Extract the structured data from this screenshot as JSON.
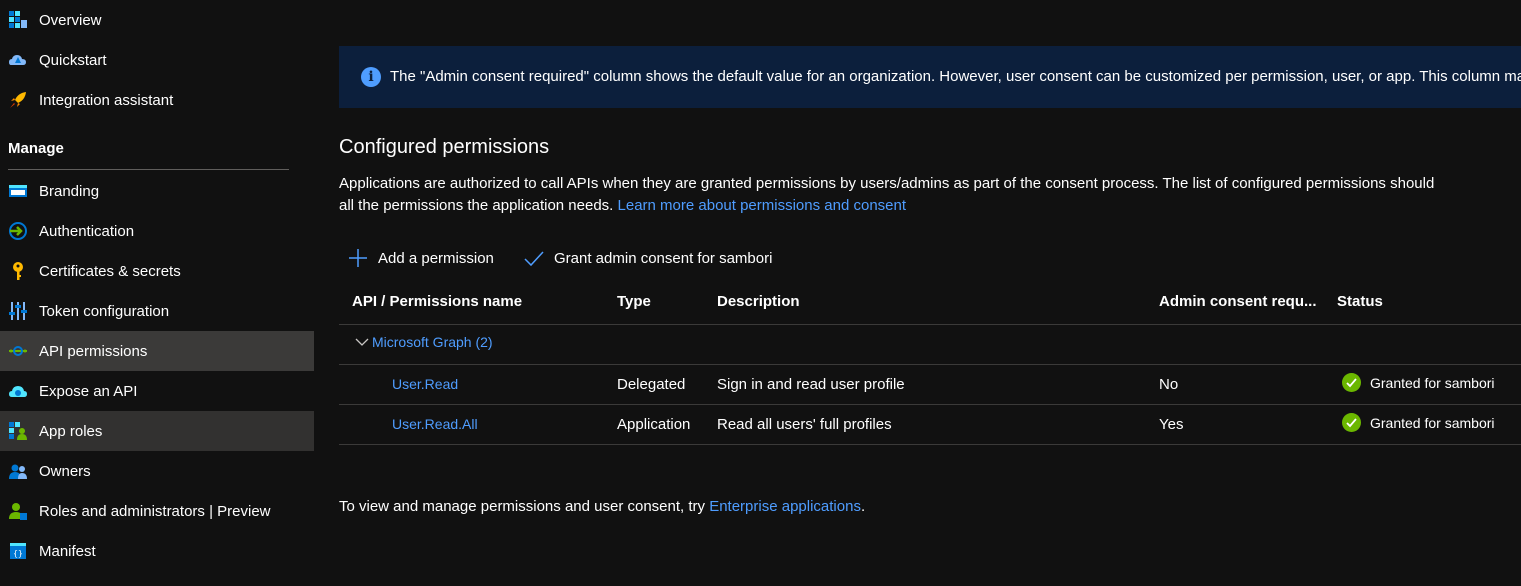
{
  "sidebar": {
    "items_top": [
      {
        "label": "Overview",
        "icon": "overview-icon"
      },
      {
        "label": "Quickstart",
        "icon": "quickstart-icon"
      },
      {
        "label": "Integration assistant",
        "icon": "rocket-icon"
      }
    ],
    "manage_heading": "Manage",
    "items": [
      {
        "label": "Branding",
        "icon": "branding-icon"
      },
      {
        "label": "Authentication",
        "icon": "authentication-icon"
      },
      {
        "label": "Certificates & secrets",
        "icon": "key-icon"
      },
      {
        "label": "Token configuration",
        "icon": "token-icon"
      },
      {
        "label": "API permissions",
        "icon": "api-permissions-icon"
      },
      {
        "label": "Expose an API",
        "icon": "cloud-icon"
      },
      {
        "label": "App roles",
        "icon": "app-roles-icon"
      },
      {
        "label": "Owners",
        "icon": "owners-icon"
      },
      {
        "label": "Roles and administrators | Preview",
        "icon": "roles-icon"
      },
      {
        "label": "Manifest",
        "icon": "manifest-icon"
      }
    ]
  },
  "info": {
    "text": "The \"Admin consent required\" column shows the default value for an organization. However, user consent can be customized per permission, user, or app. This column may"
  },
  "configured": {
    "title": "Configured permissions",
    "desc_line1": "Applications are authorized to call APIs when they are granted permissions by users/admins as part of the consent process. The list of configured permissions should",
    "desc_line2": "all the permissions the application needs.",
    "learn_more": "Learn more about permissions and consent"
  },
  "toolbar": {
    "add_label": "Add a permission",
    "grant_label": "Grant admin consent for sambori"
  },
  "table": {
    "headers": {
      "api": "API / Permissions name",
      "type": "Type",
      "description": "Description",
      "admin": "Admin consent requ...",
      "status": "Status"
    },
    "group": "Microsoft Graph (2)",
    "rows": [
      {
        "name": "User.Read",
        "type": "Delegated",
        "description": "Sign in and read user profile",
        "admin": "No",
        "status": "Granted for sambori"
      },
      {
        "name": "User.Read.All",
        "type": "Application",
        "description": "Read all users' full profiles",
        "admin": "Yes",
        "status": "Granted for sambori"
      }
    ]
  },
  "footer": {
    "text": "To view and manage permissions and user consent, try",
    "link": "Enterprise applications",
    "suffix": "."
  },
  "colors": {
    "background": "#111111",
    "link": "#4f9dff",
    "info_bar": "#0c1f3c",
    "active_item": "#3b3a39",
    "success": "#6bb700"
  }
}
